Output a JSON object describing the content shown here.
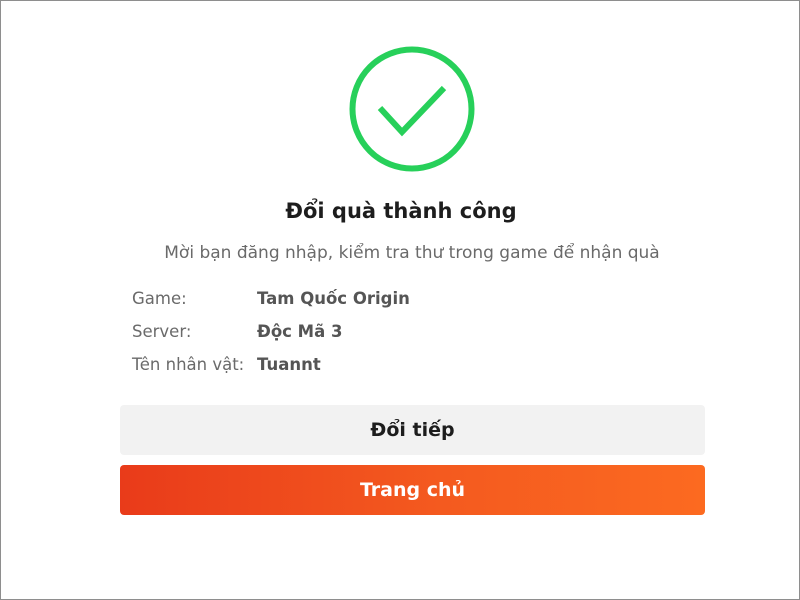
{
  "success_icon": "check-circle-icon",
  "colors": {
    "success_green": "#27d05a",
    "primary_orange": "#f25320",
    "secondary_bg": "#f2f2f2"
  },
  "dialog": {
    "title": "Đổi quà thành công",
    "subtitle": "Mời bạn đăng nhập, kiểm tra thư trong game để nhận quà",
    "details": [
      {
        "label": "Game:",
        "value": "Tam Quốc Origin"
      },
      {
        "label": "Server:",
        "value": "Độc Mã 3"
      },
      {
        "label": "Tên nhân vật:",
        "value": "Tuannt"
      }
    ],
    "buttons": {
      "continue_label": "Đổi tiếp",
      "home_label": "Trang chủ"
    }
  }
}
